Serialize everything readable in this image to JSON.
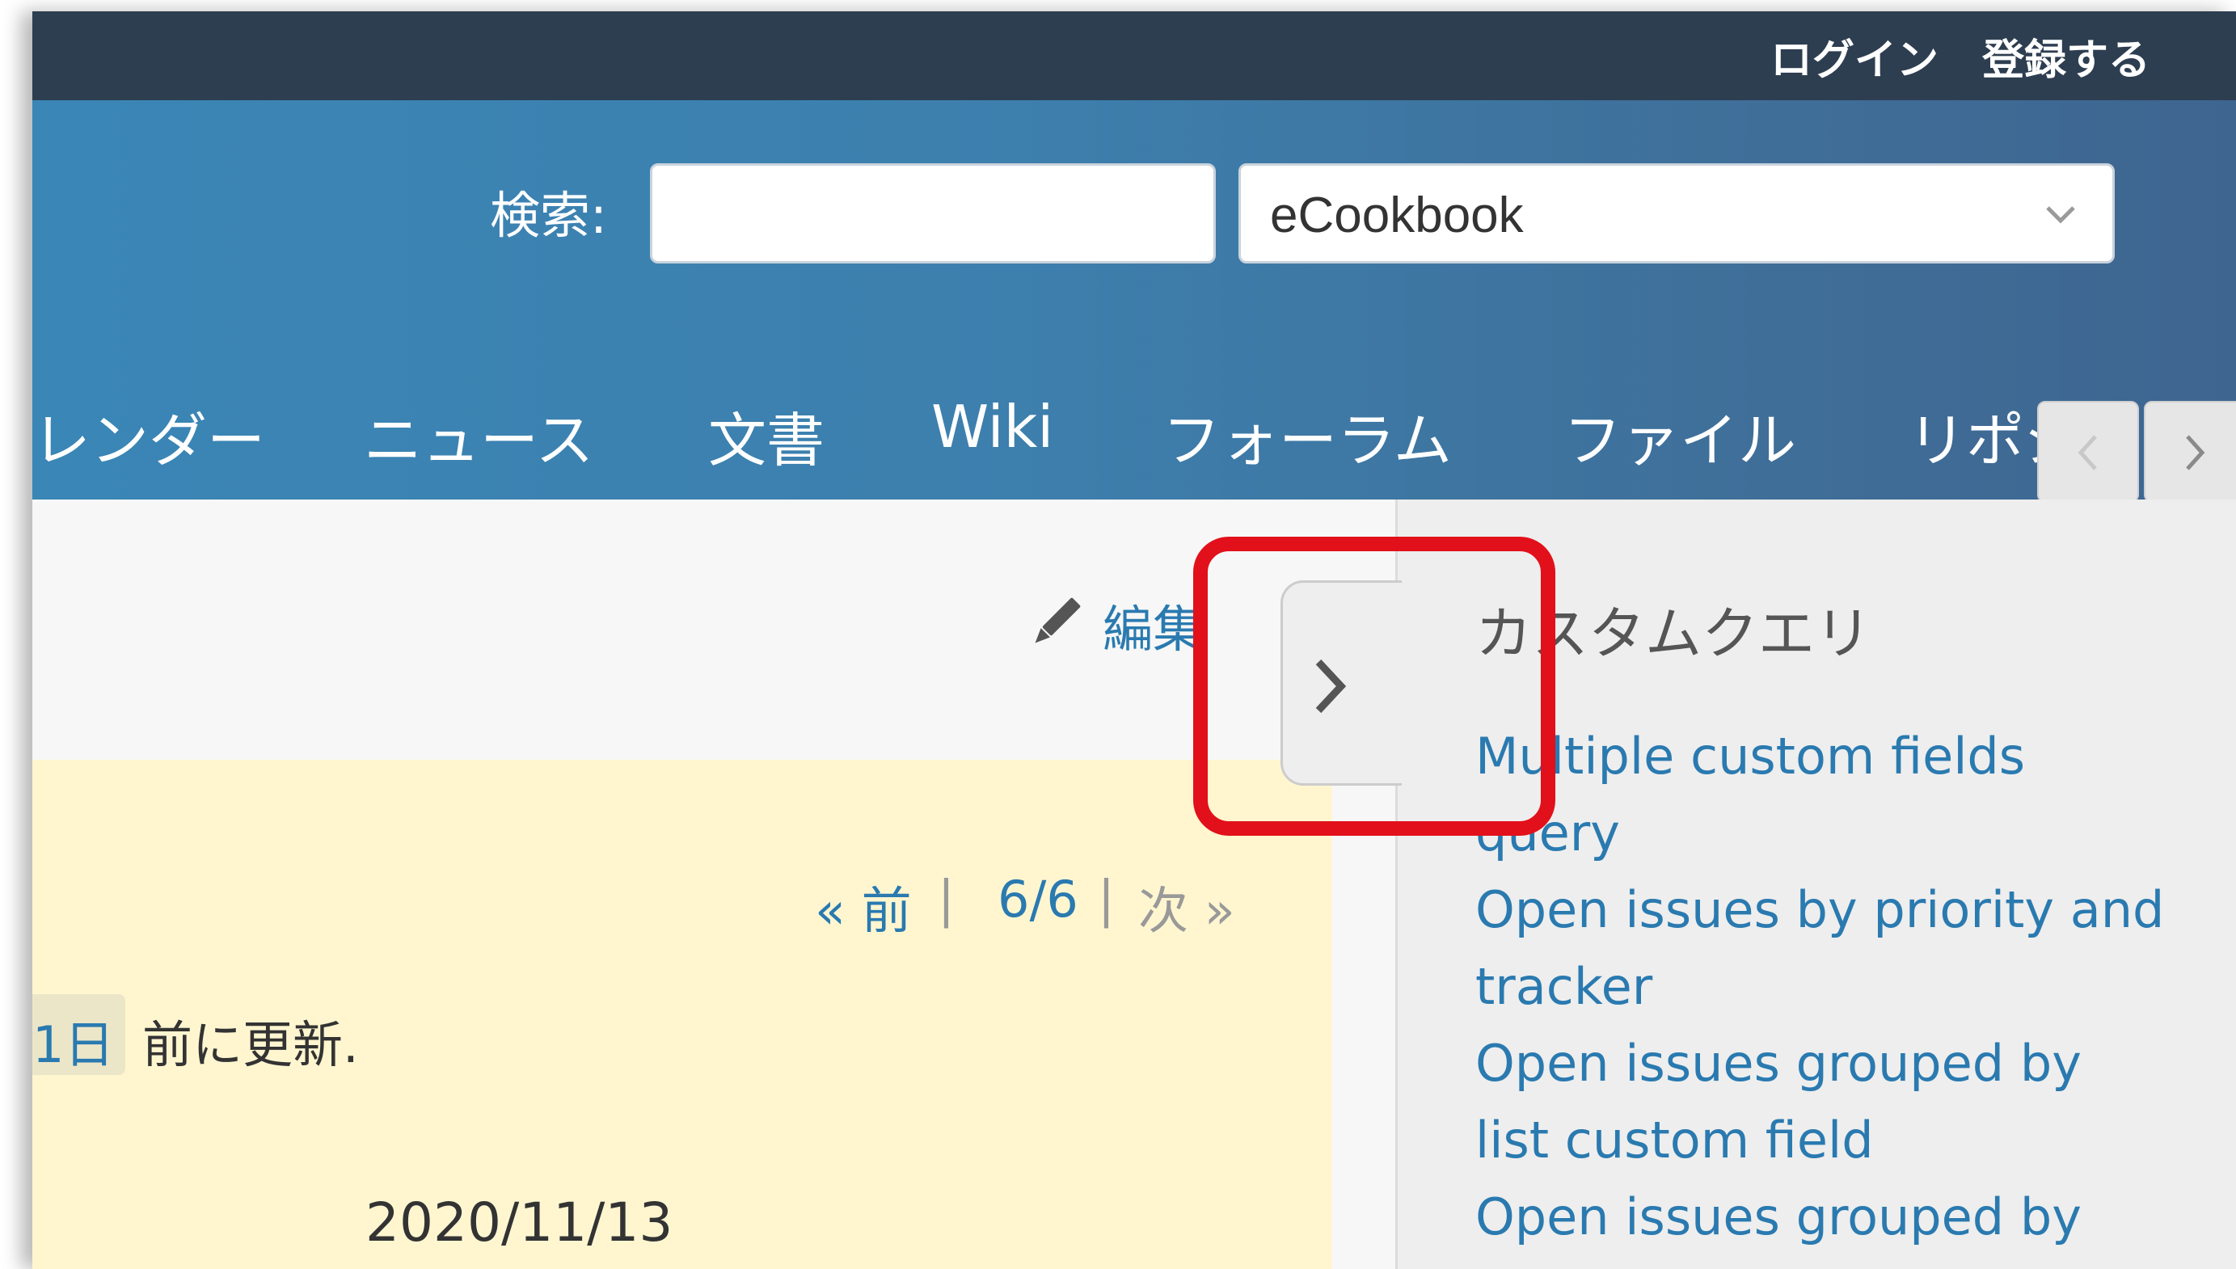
{
  "topbar": {
    "login": "ログイン",
    "register": "登録する"
  },
  "search": {
    "label": "検索:",
    "value": "",
    "placeholder": ""
  },
  "project_selector": {
    "selected": "eCookbook"
  },
  "menu": [
    "レンダー",
    "ニュース",
    "文書",
    "Wiki",
    "フォーラム",
    "ファイル",
    "リポジ"
  ],
  "content": {
    "edit_label": "編集",
    "pager": {
      "prev": "« 前",
      "sep1": "|",
      "position": "6/6",
      "sep2": "|",
      "next": "次 »"
    },
    "updated_link": "1日",
    "updated_text": "前に更新.",
    "date": "2020/11/13"
  },
  "sidebar": {
    "title": "カスタムクエリ",
    "queries": [
      "Multiple custom fields query",
      "Open issues by priority and tracker",
      "Open issues grouped by list custom field",
      "Open issues grouped by tracker"
    ]
  },
  "colors": {
    "topbar": "#2e3e51",
    "header": "#3a86b6",
    "link": "#2a7ab0",
    "note_background": "#fff6d0",
    "highlight": "#e2101a"
  }
}
